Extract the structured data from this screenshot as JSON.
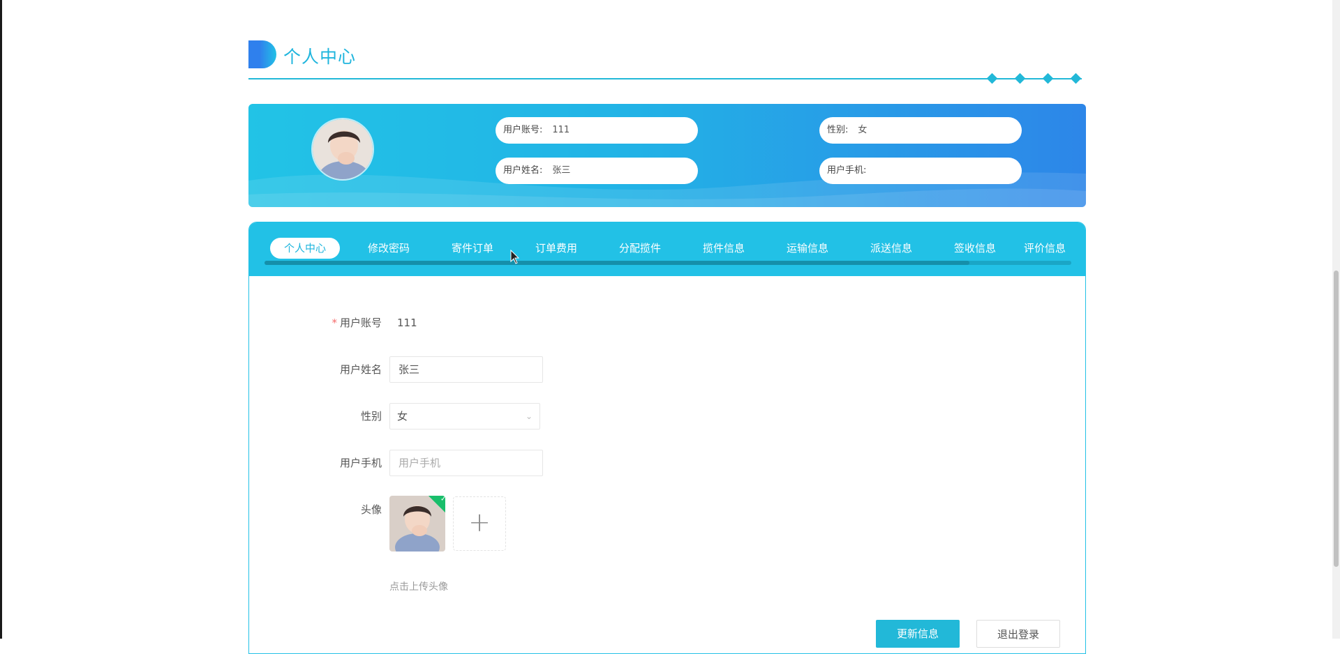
{
  "section": {
    "title": "个人中心"
  },
  "banner": {
    "account_label": "用户账号:",
    "account_value": "111",
    "name_label": "用户姓名:",
    "name_value": "张三",
    "gender_label": "性别:",
    "gender_value": "女",
    "phone_label": "用户手机:",
    "phone_value": ""
  },
  "tabs": [
    {
      "label": "个人中心",
      "active": true
    },
    {
      "label": "修改密码"
    },
    {
      "label": "寄件订单"
    },
    {
      "label": "订单费用"
    },
    {
      "label": "分配揽件"
    },
    {
      "label": "揽件信息"
    },
    {
      "label": "运输信息"
    },
    {
      "label": "派送信息"
    },
    {
      "label": "签收信息"
    },
    {
      "label": "评价信息"
    }
  ],
  "form": {
    "account_label": "用户账号",
    "account_value": "111",
    "name_label": "用户姓名",
    "name_value": "张三",
    "gender_label": "性别",
    "gender_value": "女",
    "phone_label": "用户手机",
    "phone_placeholder": "用户手机",
    "avatar_label": "头像",
    "upload_hint": "点击上传头像",
    "upload_add": "+"
  },
  "buttons": {
    "update": "更新信息",
    "logout": "退出登录"
  },
  "colors": {
    "accent": "#22c1e6",
    "accent_dark": "#2d86e8",
    "success": "#19be6b",
    "required": "#f56c6c"
  }
}
